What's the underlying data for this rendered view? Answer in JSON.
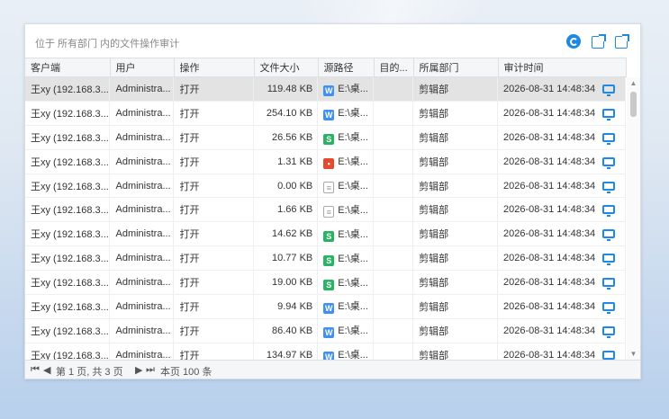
{
  "header": {
    "title": "位于 所有部门 内的文件操作审计"
  },
  "columns": [
    "客户端",
    "用户",
    "操作",
    "文件大小",
    "源路径",
    "目的...",
    "所属部门",
    "审计时间"
  ],
  "rows": [
    {
      "client": "王xy (192.168.3...",
      "user": "Administra...",
      "op": "打开",
      "size": "119.48 KB",
      "ftype": "W",
      "src": "E:\\桌...",
      "dst": "",
      "dept": "剪辑部",
      "time": "2026-08-31 14:48:34"
    },
    {
      "client": "王xy (192.168.3...",
      "user": "Administra...",
      "op": "打开",
      "size": "254.10 KB",
      "ftype": "W",
      "src": "E:\\桌...",
      "dst": "",
      "dept": "剪辑部",
      "time": "2026-08-31 14:48:34"
    },
    {
      "client": "王xy (192.168.3...",
      "user": "Administra...",
      "op": "打开",
      "size": "26.56 KB",
      "ftype": "S",
      "src": "E:\\桌...",
      "dst": "",
      "dept": "剪辑部",
      "time": "2026-08-31 14:48:34"
    },
    {
      "client": "王xy (192.168.3...",
      "user": "Administra...",
      "op": "打开",
      "size": "1.31 KB",
      "ftype": "R",
      "src": "E:\\桌...",
      "dst": "",
      "dept": "剪辑部",
      "time": "2026-08-31 14:48:34"
    },
    {
      "client": "王xy (192.168.3...",
      "user": "Administra...",
      "op": "打开",
      "size": "0.00 KB",
      "ftype": "T",
      "src": "E:\\桌...",
      "dst": "",
      "dept": "剪辑部",
      "time": "2026-08-31 14:48:34"
    },
    {
      "client": "王xy (192.168.3...",
      "user": "Administra...",
      "op": "打开",
      "size": "1.66 KB",
      "ftype": "T",
      "src": "E:\\桌...",
      "dst": "",
      "dept": "剪辑部",
      "time": "2026-08-31 14:48:34"
    },
    {
      "client": "王xy (192.168.3...",
      "user": "Administra...",
      "op": "打开",
      "size": "14.62 KB",
      "ftype": "S",
      "src": "E:\\桌...",
      "dst": "",
      "dept": "剪辑部",
      "time": "2026-08-31 14:48:34"
    },
    {
      "client": "王xy (192.168.3...",
      "user": "Administra...",
      "op": "打开",
      "size": "10.77 KB",
      "ftype": "S",
      "src": "E:\\桌...",
      "dst": "",
      "dept": "剪辑部",
      "time": "2026-08-31 14:48:34"
    },
    {
      "client": "王xy (192.168.3...",
      "user": "Administra...",
      "op": "打开",
      "size": "19.00 KB",
      "ftype": "S",
      "src": "E:\\桌...",
      "dst": "",
      "dept": "剪辑部",
      "time": "2026-08-31 14:48:34"
    },
    {
      "client": "王xy (192.168.3...",
      "user": "Administra...",
      "op": "打开",
      "size": "9.94 KB",
      "ftype": "W",
      "src": "E:\\桌...",
      "dst": "",
      "dept": "剪辑部",
      "time": "2026-08-31 14:48:34"
    },
    {
      "client": "王xy (192.168.3...",
      "user": "Administra...",
      "op": "打开",
      "size": "86.40 KB",
      "ftype": "W",
      "src": "E:\\桌...",
      "dst": "",
      "dept": "剪辑部",
      "time": "2026-08-31 14:48:34"
    },
    {
      "client": "王xy (192.168.3...",
      "user": "Administra...",
      "op": "打开",
      "size": "134.97 KB",
      "ftype": "W",
      "src": "E:\\桌...",
      "dst": "",
      "dept": "剪辑部",
      "time": "2026-08-31 14:48:34"
    }
  ],
  "pager": {
    "first": "⏮",
    "prev": "◀",
    "page_text": "第 1 页, 共 3 页",
    "next": "▶",
    "last": "⏭",
    "count_text": "本页 100 条"
  },
  "icons": {
    "refresh": "refresh-icon",
    "export": "export-icon",
    "export2": "export-icon",
    "client_device": "monitor-icon"
  },
  "colors": {
    "accent": "#1e88e5",
    "word": "#3f8ff5",
    "sheet": "#28b463",
    "pdf": "#e64a2e",
    "selected_row": "#e3e3e3"
  }
}
